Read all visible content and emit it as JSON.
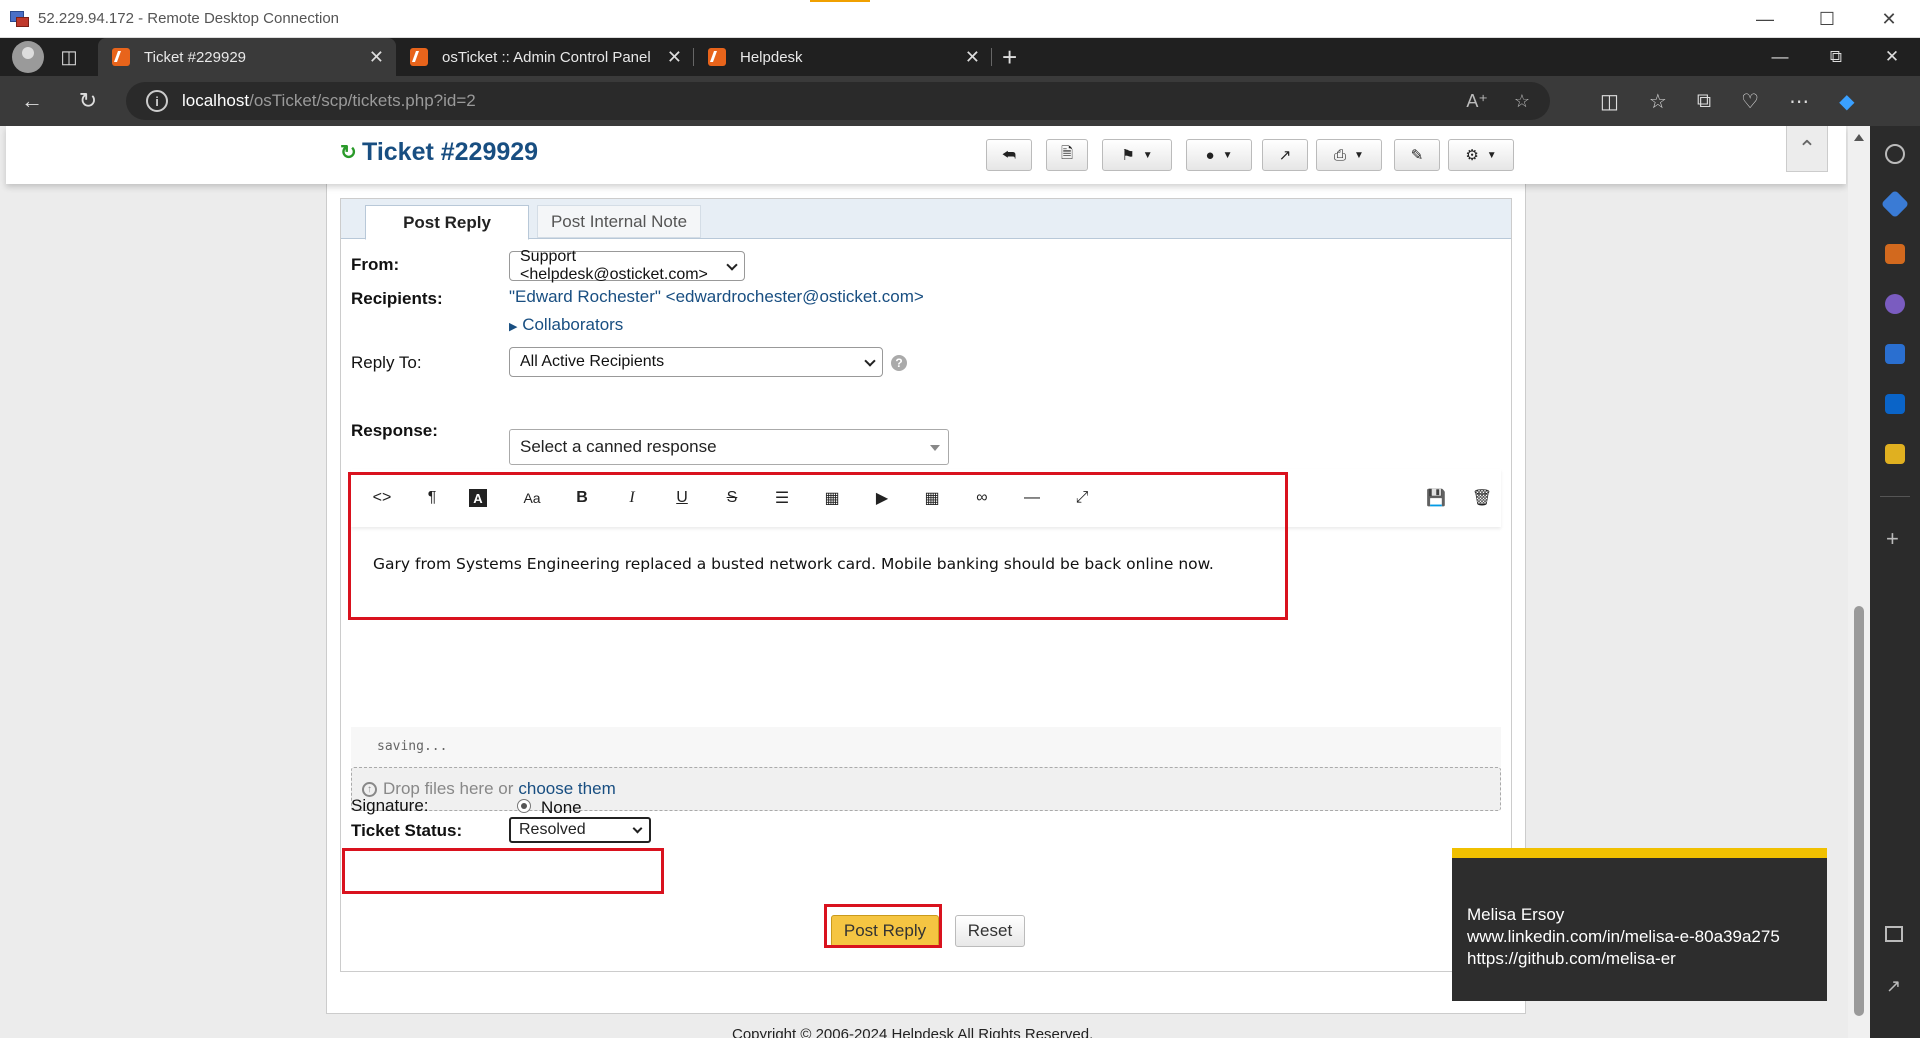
{
  "rdp": {
    "title": "52.229.94.172 - Remote Desktop Connection"
  },
  "browser": {
    "tabs": [
      {
        "label": "Ticket #229929"
      },
      {
        "label": "osTicket :: Admin Control Panel"
      },
      {
        "label": "Helpdesk"
      }
    ],
    "url_host": "localhost",
    "url_path": "/osTicket/scp/tickets.php?id=2"
  },
  "ticket": {
    "title": "Ticket #229929",
    "tabs": {
      "post_reply": "Post Reply",
      "internal_note": "Post Internal Note"
    },
    "from_label": "From:",
    "from_value": "Support <helpdesk@osticket.com>",
    "recipients_label": "Recipients:",
    "recipients_value": "\"Edward Rochester\" <edwardrochester@osticket.com>",
    "collaborators": "Collaborators",
    "reply_to_label": "Reply To:",
    "reply_to_value": "All Active Recipients",
    "response_label": "Response:",
    "canned_placeholder": "Select a canned response",
    "message": "Gary from Systems Engineering replaced a busted network card. Mobile banking should be back online now.",
    "saving": "saving...",
    "drop_text": "Drop files here or",
    "drop_link": "choose them",
    "signature_label": "Signature:",
    "signature_value": "None",
    "status_label": "Ticket Status:",
    "status_value": "Resolved",
    "post_button": "Post Reply",
    "reset_button": "Reset"
  },
  "footer": {
    "copyright": "Copyright © 2006-2024 Helpdesk All Rights Reserved."
  },
  "watermark": {
    "name": "Melisa Ersoy",
    "linkedin": "www.linkedin.com/in/melisa-e-80a39a275",
    "github": "https://github.com/melisa-er"
  },
  "colors": {
    "accent_red": "#d9121e",
    "post_button": "#f5c542",
    "title_blue": "#184e81"
  }
}
